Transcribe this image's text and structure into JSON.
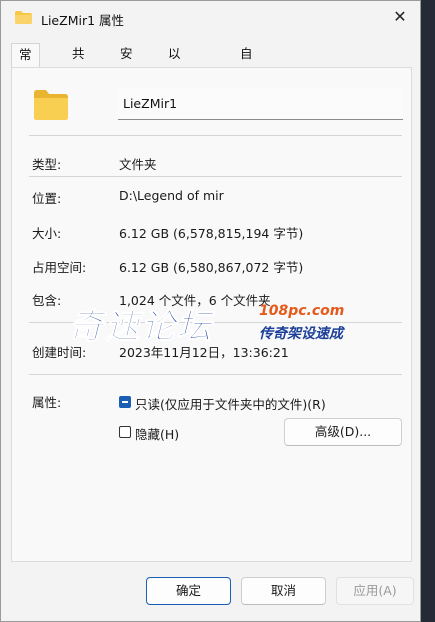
{
  "window": {
    "title": "LieZMir1 属性",
    "close_glyph": "✕"
  },
  "tabs": [
    {
      "label": "常规",
      "active": true
    },
    {
      "label": "共享",
      "active": false
    },
    {
      "label": "安全",
      "active": false
    },
    {
      "label": "以前的版本",
      "active": false
    },
    {
      "label": "自定义",
      "active": false
    }
  ],
  "general": {
    "name": "LieZMir1",
    "rows": {
      "type": {
        "label": "类型:",
        "value": "文件夹"
      },
      "location": {
        "label": "位置:",
        "value": "D:\\Legend of mir"
      },
      "size": {
        "label": "大小:",
        "value": "6.12 GB (6,578,815,194 字节)"
      },
      "size_on_disk": {
        "label": "占用空间:",
        "value": "6.12 GB (6,580,867,072 字节)"
      },
      "contains": {
        "label": "包含:",
        "value": "1,024 个文件，6 个文件夹"
      },
      "created": {
        "label": "创建时间:",
        "value": "2023年11月12日，13:36:21"
      }
    },
    "attributes": {
      "label": "属性:",
      "readonly": {
        "label": "只读(仅应用于文件夹中的文件)(R)",
        "state": "indeterminate"
      },
      "hidden": {
        "label": "隐藏(H)",
        "checked": false
      },
      "advanced_button": "高级(D)..."
    }
  },
  "footer": {
    "ok": "确定",
    "cancel": "取消",
    "apply": "应用(A)"
  },
  "watermark": {
    "brand": "奇速论坛",
    "url": "108pc.com",
    "slogan": "传奇架设速成"
  },
  "colors": {
    "accent": "#1a5fb4",
    "folder": "#f7c843",
    "watermark_blue": "#1c3f9a",
    "watermark_orange": "#e55a1a"
  },
  "icons": {
    "title": "folder-icon",
    "big": "folder-icon",
    "close": "close-icon"
  }
}
